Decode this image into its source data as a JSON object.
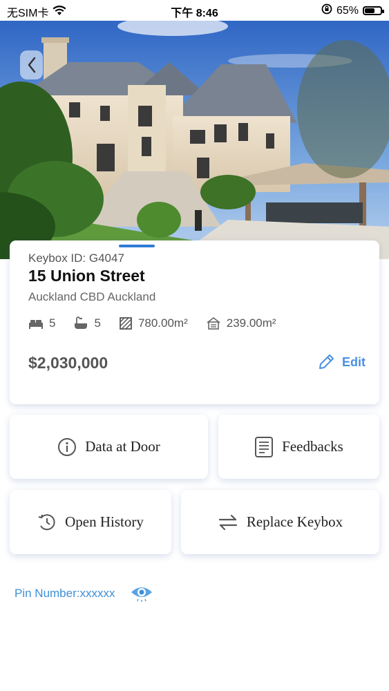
{
  "status_bar": {
    "carrier": "无SIM卡",
    "time": "下午 8:46",
    "battery": "65%",
    "battery_level": 0.65
  },
  "hero": {
    "image": "luxury-mansion-photo",
    "slide_count": 3,
    "active_slide": 1
  },
  "property": {
    "keybox_id": "Keybox ID: G4047",
    "address": "15 Union Street",
    "suburb": "Auckland CBD Auckland",
    "bedrooms": "5",
    "bathrooms": "5",
    "land_area": "780.00m²",
    "floor_area": "239.00m²",
    "price": "$2,030,000",
    "edit_label": "Edit"
  },
  "actions": {
    "data_at_door": "Data at Door",
    "feedbacks": "Feedbacks",
    "open_history": "Open History",
    "replace_keybox": "Replace Keybox"
  },
  "pin": {
    "label": "Pin Number:xxxxxx"
  },
  "colors": {
    "accent": "#4a90e2",
    "pin_text": "#3d8fd6",
    "active_dot": "#2f7bd6"
  }
}
